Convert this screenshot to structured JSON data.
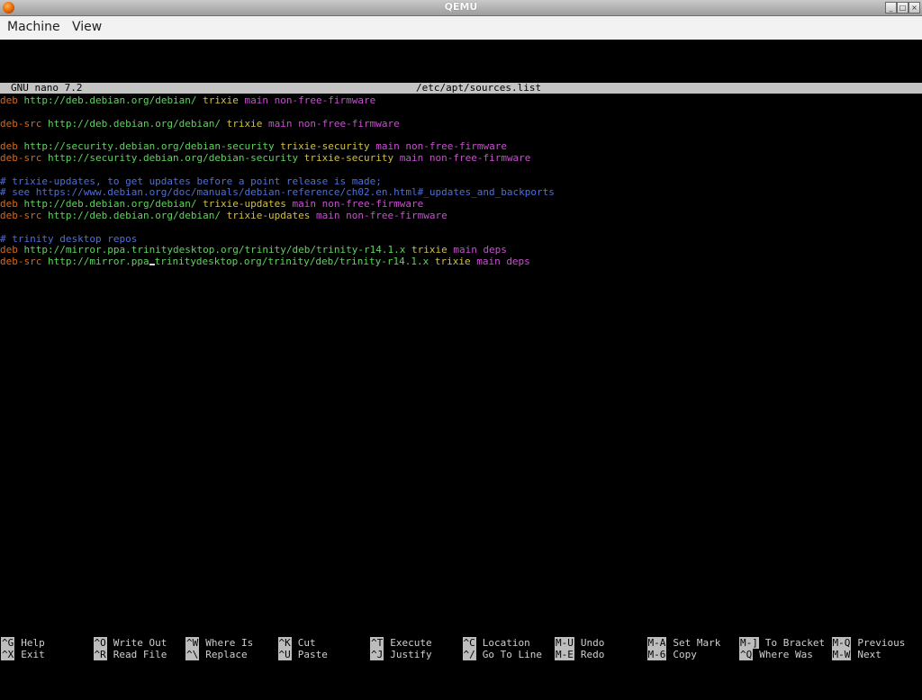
{
  "window": {
    "title": "QEMU",
    "buttons": [
      "_",
      "□",
      "×"
    ]
  },
  "menubar": {
    "items": [
      "Machine",
      "View"
    ]
  },
  "nano": {
    "version": "GNU nano 7.2",
    "filename": "/etc/apt/sources.list"
  },
  "lines": [
    {
      "parts": [
        {
          "t": "deb",
          "c": "c-deb"
        },
        {
          "t": " http://deb.debian.org/debian/",
          "c": "c-url"
        },
        {
          "t": " trixie",
          "c": "c-dist"
        },
        {
          "t": " main non-free-firmware",
          "c": "c-comp"
        }
      ]
    },
    {
      "parts": []
    },
    {
      "parts": [
        {
          "t": "deb-src",
          "c": "c-deb"
        },
        {
          "t": " http://deb.debian.org/debian/",
          "c": "c-url"
        },
        {
          "t": " trixie",
          "c": "c-dist"
        },
        {
          "t": " main non-free-firmware",
          "c": "c-comp"
        }
      ]
    },
    {
      "parts": []
    },
    {
      "parts": [
        {
          "t": "deb",
          "c": "c-deb"
        },
        {
          "t": " http://security.debian.org/debian-security",
          "c": "c-url"
        },
        {
          "t": " trixie-security",
          "c": "c-dist"
        },
        {
          "t": " main non-free-firmware",
          "c": "c-comp"
        }
      ]
    },
    {
      "parts": [
        {
          "t": "deb-src",
          "c": "c-deb"
        },
        {
          "t": " http://security.debian.org/debian-security",
          "c": "c-url"
        },
        {
          "t": " trixie-security",
          "c": "c-dist"
        },
        {
          "t": " main non-free-firmware",
          "c": "c-comp"
        }
      ]
    },
    {
      "parts": []
    },
    {
      "parts": [
        {
          "t": "# trixie-updates, to get updates before a point release is made;",
          "c": "c-cmt"
        }
      ]
    },
    {
      "parts": [
        {
          "t": "# see https://www.debian.org/doc/manuals/debian-reference/ch02.en.html#_updates_and_backports",
          "c": "c-cmt"
        }
      ]
    },
    {
      "parts": [
        {
          "t": "deb",
          "c": "c-deb"
        },
        {
          "t": " http://deb.debian.org/debian/",
          "c": "c-url"
        },
        {
          "t": " trixie-updates",
          "c": "c-dist"
        },
        {
          "t": " main non-free-firmware",
          "c": "c-comp"
        }
      ]
    },
    {
      "parts": [
        {
          "t": "deb-src",
          "c": "c-deb"
        },
        {
          "t": " http://deb.debian.org/debian/",
          "c": "c-url"
        },
        {
          "t": " trixie-updates",
          "c": "c-dist"
        },
        {
          "t": " main non-free-firmware",
          "c": "c-comp"
        }
      ]
    },
    {
      "parts": []
    },
    {
      "parts": [
        {
          "t": "# trinity desktop repos",
          "c": "c-cmt"
        }
      ]
    },
    {
      "parts": [
        {
          "t": "deb",
          "c": "c-deb"
        },
        {
          "t": " http://mirror.ppa.trinitydesktop.org/trinity/deb/trinity-r14.1.x",
          "c": "c-url"
        },
        {
          "t": " trixie",
          "c": "c-dist"
        },
        {
          "t": " main deps",
          "c": "c-comp"
        }
      ]
    },
    {
      "parts": [
        {
          "t": "deb-src",
          "c": "c-deb"
        },
        {
          "t": " http://mirror.ppa",
          "c": "c-url"
        },
        {
          "t": "CURSOR",
          "c": "cursor"
        },
        {
          "t": "trinitydesktop.org/trinity/deb/trinity-r14.1.x",
          "c": "c-url"
        },
        {
          "t": " trixie",
          "c": "c-dist"
        },
        {
          "t": " main deps",
          "c": "c-comp"
        }
      ]
    }
  ],
  "shortcuts": [
    [
      {
        "key": "^G",
        "label": "Help"
      },
      {
        "key": "^X",
        "label": "Exit"
      }
    ],
    [
      {
        "key": "^O",
        "label": "Write Out"
      },
      {
        "key": "^R",
        "label": "Read File"
      }
    ],
    [
      {
        "key": "^W",
        "label": "Where Is"
      },
      {
        "key": "^\\",
        "label": "Replace"
      }
    ],
    [
      {
        "key": "^K",
        "label": "Cut"
      },
      {
        "key": "^U",
        "label": "Paste"
      }
    ],
    [
      {
        "key": "^T",
        "label": "Execute"
      },
      {
        "key": "^J",
        "label": "Justify"
      }
    ],
    [
      {
        "key": "^C",
        "label": "Location"
      },
      {
        "key": "^/",
        "label": "Go To Line"
      }
    ],
    [
      {
        "key": "M-U",
        "label": "Undo"
      },
      {
        "key": "M-E",
        "label": "Redo"
      }
    ],
    [
      {
        "key": "M-A",
        "label": "Set Mark"
      },
      {
        "key": "M-6",
        "label": "Copy"
      }
    ],
    [
      {
        "key": "M-]",
        "label": "To Bracket"
      },
      {
        "key": "^Q",
        "label": "Where Was"
      }
    ],
    [
      {
        "key": "M-Q",
        "label": "Previous"
      },
      {
        "key": "M-W",
        "label": "Next"
      }
    ]
  ]
}
